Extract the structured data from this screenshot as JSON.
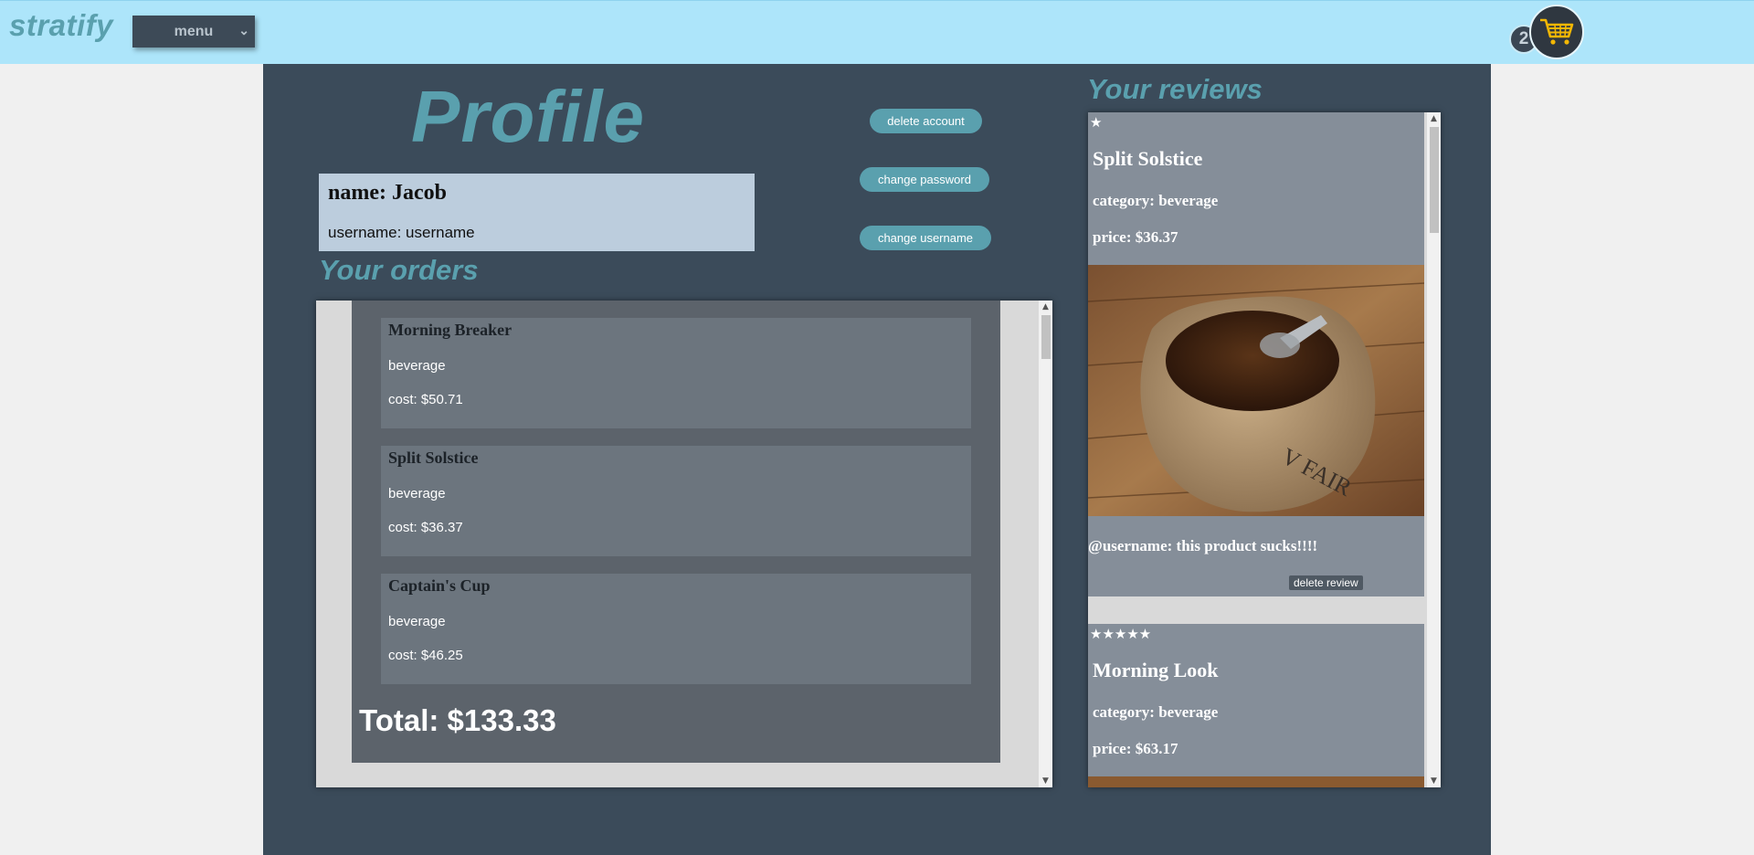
{
  "header": {
    "logo": "stratify",
    "menu_label": "menu",
    "cart_count": "2"
  },
  "profile": {
    "title": "Profile",
    "name": "name: Jacob",
    "username": "username: username",
    "buttons": {
      "delete_account": "delete account",
      "change_password": "change password",
      "change_username": "change username"
    }
  },
  "orders": {
    "title": "Your orders",
    "items": [
      {
        "name": "Morning Breaker",
        "category": "beverage",
        "cost": "cost: $50.71"
      },
      {
        "name": "Split Solstice",
        "category": "beverage",
        "cost": "cost: $36.37"
      },
      {
        "name": "Captain's Cup",
        "category": "beverage",
        "cost": "cost: $46.25"
      }
    ],
    "total": "Total: $133.33"
  },
  "reviews": {
    "title": "Your reviews",
    "items": [
      {
        "stars": "★",
        "rating": 1,
        "name": "Split Solstice",
        "category": "category: beverage",
        "price": "price: $36.37",
        "image_icon": "coffee-sack-image",
        "text": "@username: this product sucks!!!!",
        "delete_label": "delete review"
      },
      {
        "stars": "★★★★★",
        "rating": 5,
        "name": "Morning Look",
        "category": "category: beverage",
        "price": "price: $63.17"
      }
    ]
  },
  "colors": {
    "accent": "#5aa0ae",
    "topbar": "#ade5fa",
    "main_bg": "#3b4b5a",
    "cart_yellow": "#f2b705"
  }
}
